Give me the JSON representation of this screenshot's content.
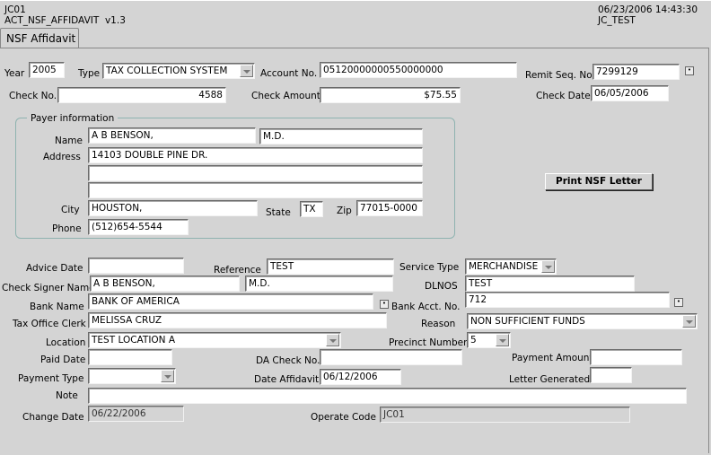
{
  "header": {
    "code": "JC01",
    "form_name": "ACT_NSF_AFFIDAVIT",
    "version": "v1.3",
    "datetime": "06/23/2006 14:43:30",
    "user": "JC_TEST"
  },
  "tab": {
    "label": "NSF Affidavit"
  },
  "fields": {
    "year": {
      "label": "Year",
      "value": "2005"
    },
    "type": {
      "label": "Type",
      "value": "TAX COLLECTION SYSTEM"
    },
    "account_no": {
      "label": "Account No.",
      "value": "05120000000550000000"
    },
    "remit_seq_no": {
      "label": "Remit Seq. No.",
      "value": "7299129"
    },
    "check_no": {
      "label": "Check No.",
      "value": "4588"
    },
    "check_amount": {
      "label": "Check Amount",
      "value": "$75.55"
    },
    "check_date": {
      "label": "Check Date",
      "value": "06/05/2006"
    }
  },
  "payer": {
    "title": "Payer information",
    "name_label": "Name",
    "name": "A B BENSON,",
    "name_suffix": "M.D.",
    "address_label": "Address",
    "address1": "14103 DOUBLE PINE DR.",
    "address2": "",
    "address3": "",
    "city_label": "City",
    "city": "HOUSTON,",
    "state_label": "State",
    "state": "TX",
    "zip_label": "Zip",
    "zip": "77015-0000",
    "phone_label": "Phone",
    "phone": "(512)654-5544"
  },
  "print_button": "Print NSF Letter",
  "details": {
    "advice_date_label": "Advice Date",
    "advice_date": "",
    "reference_label": "Reference",
    "reference": "TEST",
    "service_type_label": "Service Type",
    "service_type": "MERCHANDISE",
    "check_signer_label": "Check Signer Name",
    "check_signer": "A B BENSON,",
    "check_signer_suffix": "M.D.",
    "dlnos_label": "DLNOS",
    "dlnos": "TEST",
    "bank_name_label": "Bank Name",
    "bank_name": "BANK OF AMERICA",
    "bank_acct_label": "Bank Acct. No.",
    "bank_acct": "712",
    "clerk_label": "Tax Office Clerk",
    "clerk": "MELISSA CRUZ",
    "reason_label": "Reason",
    "reason": "NON SUFFICIENT FUNDS",
    "location_label": "Location",
    "location": "TEST LOCATION A",
    "precinct_label": "Precinct Number",
    "precinct": "5",
    "paid_date_label": "Paid Date",
    "paid_date": "",
    "da_check_label": "DA Check No.",
    "da_check": "",
    "payment_amount_label": "Payment Amount",
    "payment_amount": "",
    "payment_type_label": "Payment Type",
    "payment_type": "",
    "date_affidavit_label": "Date Affidavit",
    "date_affidavit": "06/12/2006",
    "letter_generated_label": "Letter Generated",
    "letter_generated": "",
    "note_label": "Note",
    "note": "",
    "change_date_label": "Change Date",
    "change_date": "06/22/2006",
    "operate_code_label": "Operate Code",
    "operate_code": "JC01"
  },
  "colors": {
    "background": "#d4d4d4",
    "field": "#ffffff",
    "group_border": "#8fb3b0"
  }
}
